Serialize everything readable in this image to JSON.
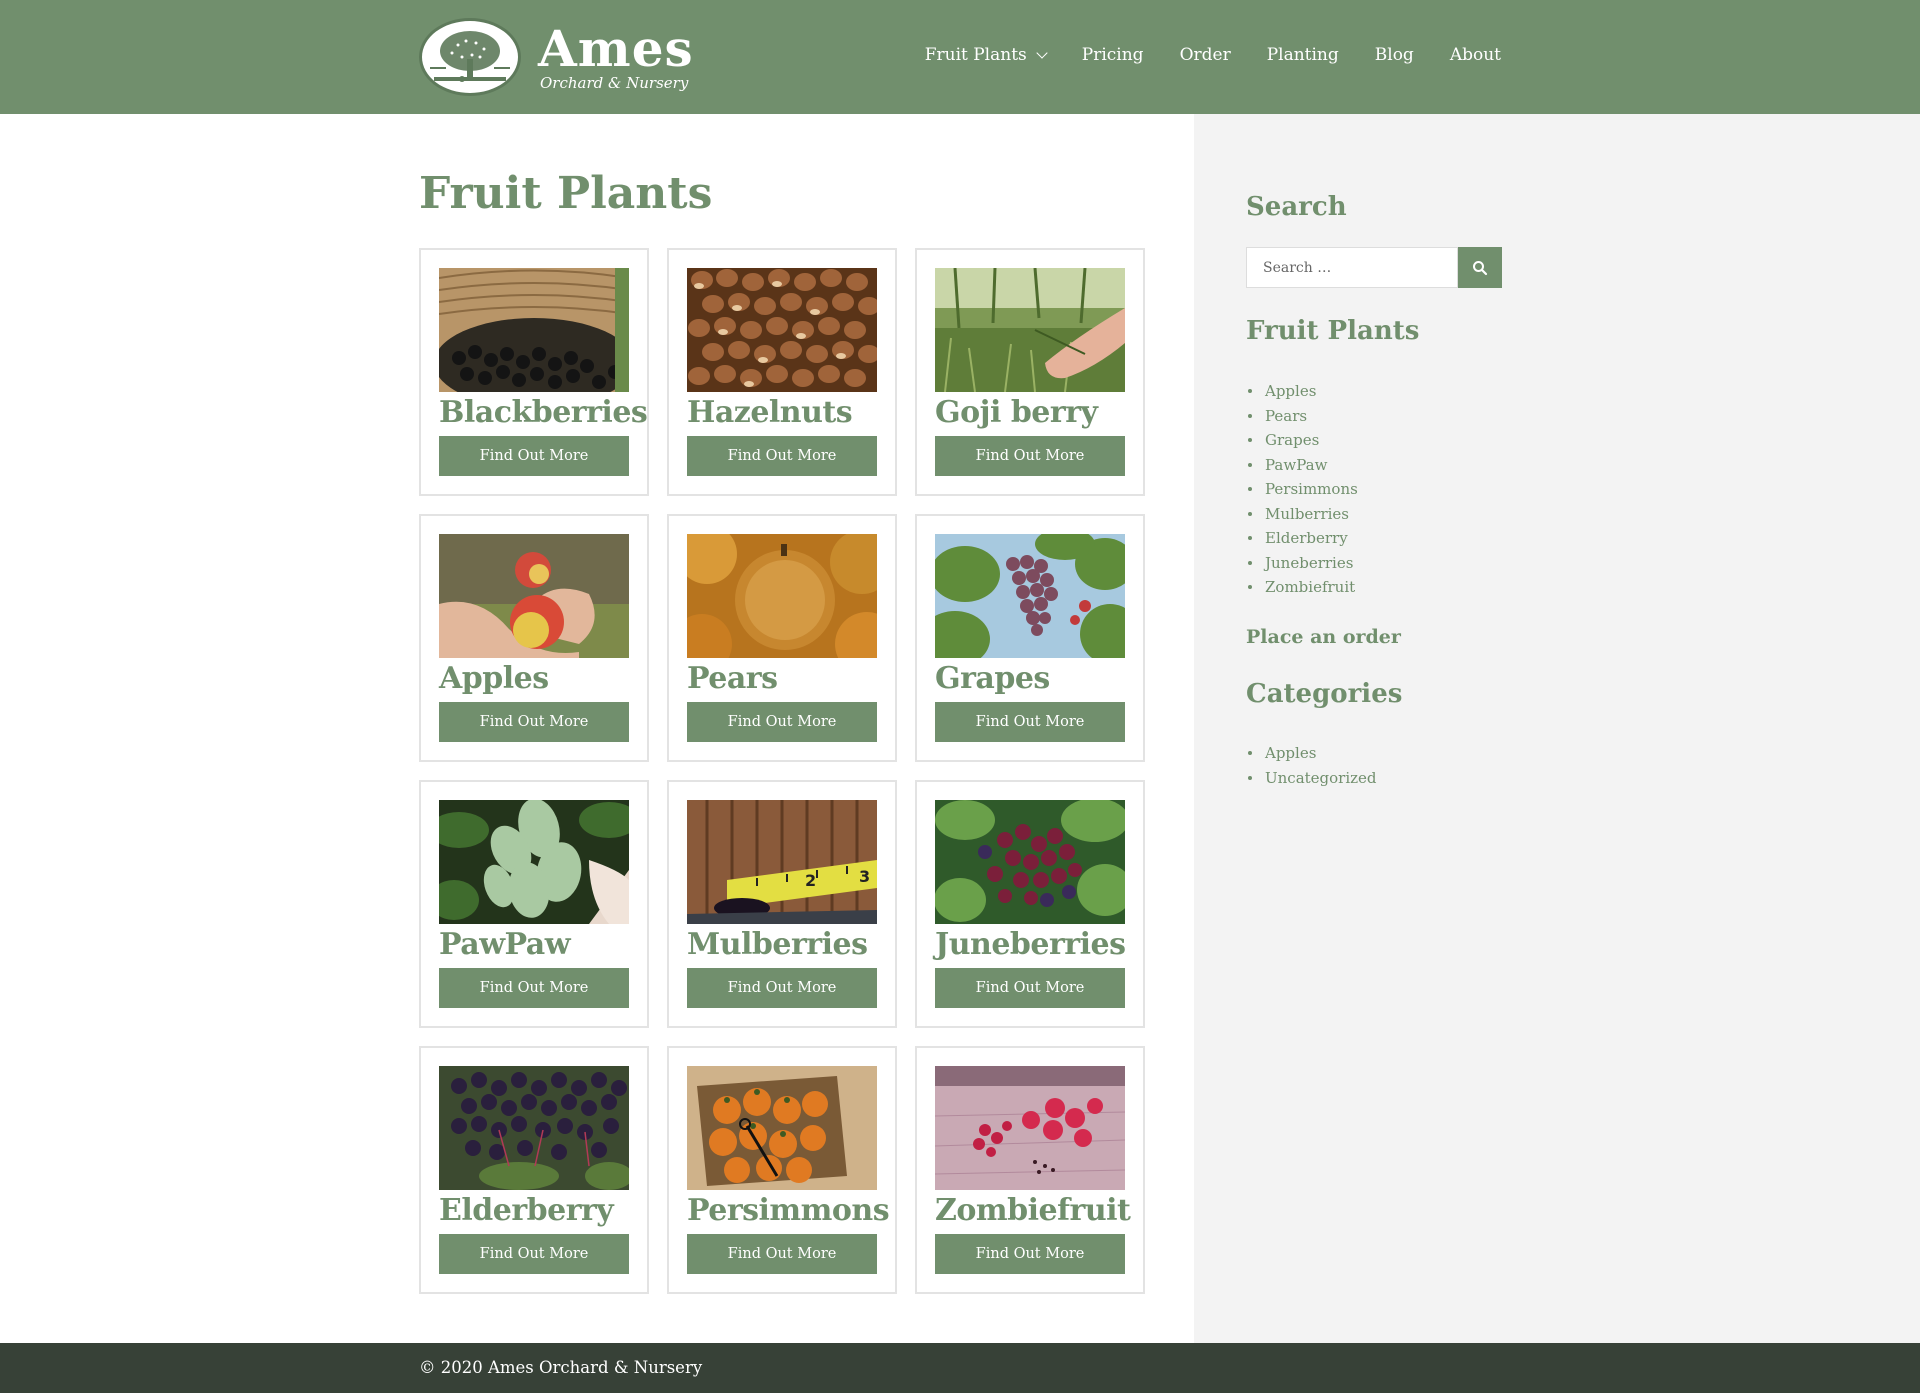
{
  "header": {
    "logo_title": "Ames",
    "logo_tagline": "Orchard & Nursery",
    "logo_icon": "orchard-tree-emblem",
    "nav": [
      {
        "label": "Fruit Plants",
        "has_dropdown": true
      },
      {
        "label": "Pricing"
      },
      {
        "label": "Order"
      },
      {
        "label": "Planting"
      },
      {
        "label": "Blog"
      },
      {
        "label": "About"
      }
    ]
  },
  "main": {
    "title": "Fruit Plants",
    "cards": [
      {
        "title": "Blackberries",
        "button": "Find Out More",
        "image": "blackberries-basket-photo"
      },
      {
        "title": "Hazelnuts",
        "button": "Find Out More",
        "image": "hazelnuts-pile-photo"
      },
      {
        "title": "Goji berry",
        "button": "Find Out More",
        "image": "goji-plant-hand-photo"
      },
      {
        "title": "Apples",
        "button": "Find Out More",
        "image": "apples-in-hand-photo"
      },
      {
        "title": "Pears",
        "button": "Find Out More",
        "image": "asian-pears-photo"
      },
      {
        "title": "Grapes",
        "button": "Find Out More",
        "image": "grape-cluster-photo"
      },
      {
        "title": "PawPaw",
        "button": "Find Out More",
        "image": "pawpaw-fruit-photo"
      },
      {
        "title": "Mulberries",
        "button": "Find Out More",
        "image": "mulberry-tape-measure-photo"
      },
      {
        "title": "Juneberries",
        "button": "Find Out More",
        "image": "juneberries-branch-photo"
      },
      {
        "title": "Elderberry",
        "button": "Find Out More",
        "image": "elderberry-clusters-photo"
      },
      {
        "title": "Persimmons",
        "button": "Find Out More",
        "image": "persimmons-box-photo"
      },
      {
        "title": "Zombiefruit",
        "button": "Find Out More",
        "image": "zombiefruit-berries-photo"
      }
    ]
  },
  "sidebar": {
    "search_title": "Search",
    "search_placeholder": "Search …",
    "search_icon": "search-icon",
    "fruit_plants_title": "Fruit Plants",
    "fruit_plants": [
      "Apples",
      "Pears",
      "Grapes",
      "PawPaw",
      "Persimmons",
      "Mulberries",
      "Elderberry",
      "Juneberries",
      "Zombiefruit"
    ],
    "place_order": "Place an order",
    "categories_title": "Categories",
    "categories": [
      "Apples",
      "Uncategorized"
    ]
  },
  "footer": {
    "copyright": "© 2020 Ames Orchard & Nursery"
  },
  "colors": {
    "brand_green": "#718f6d",
    "footer_dark": "#374137",
    "sidebar_bg": "#f3f3f3"
  }
}
